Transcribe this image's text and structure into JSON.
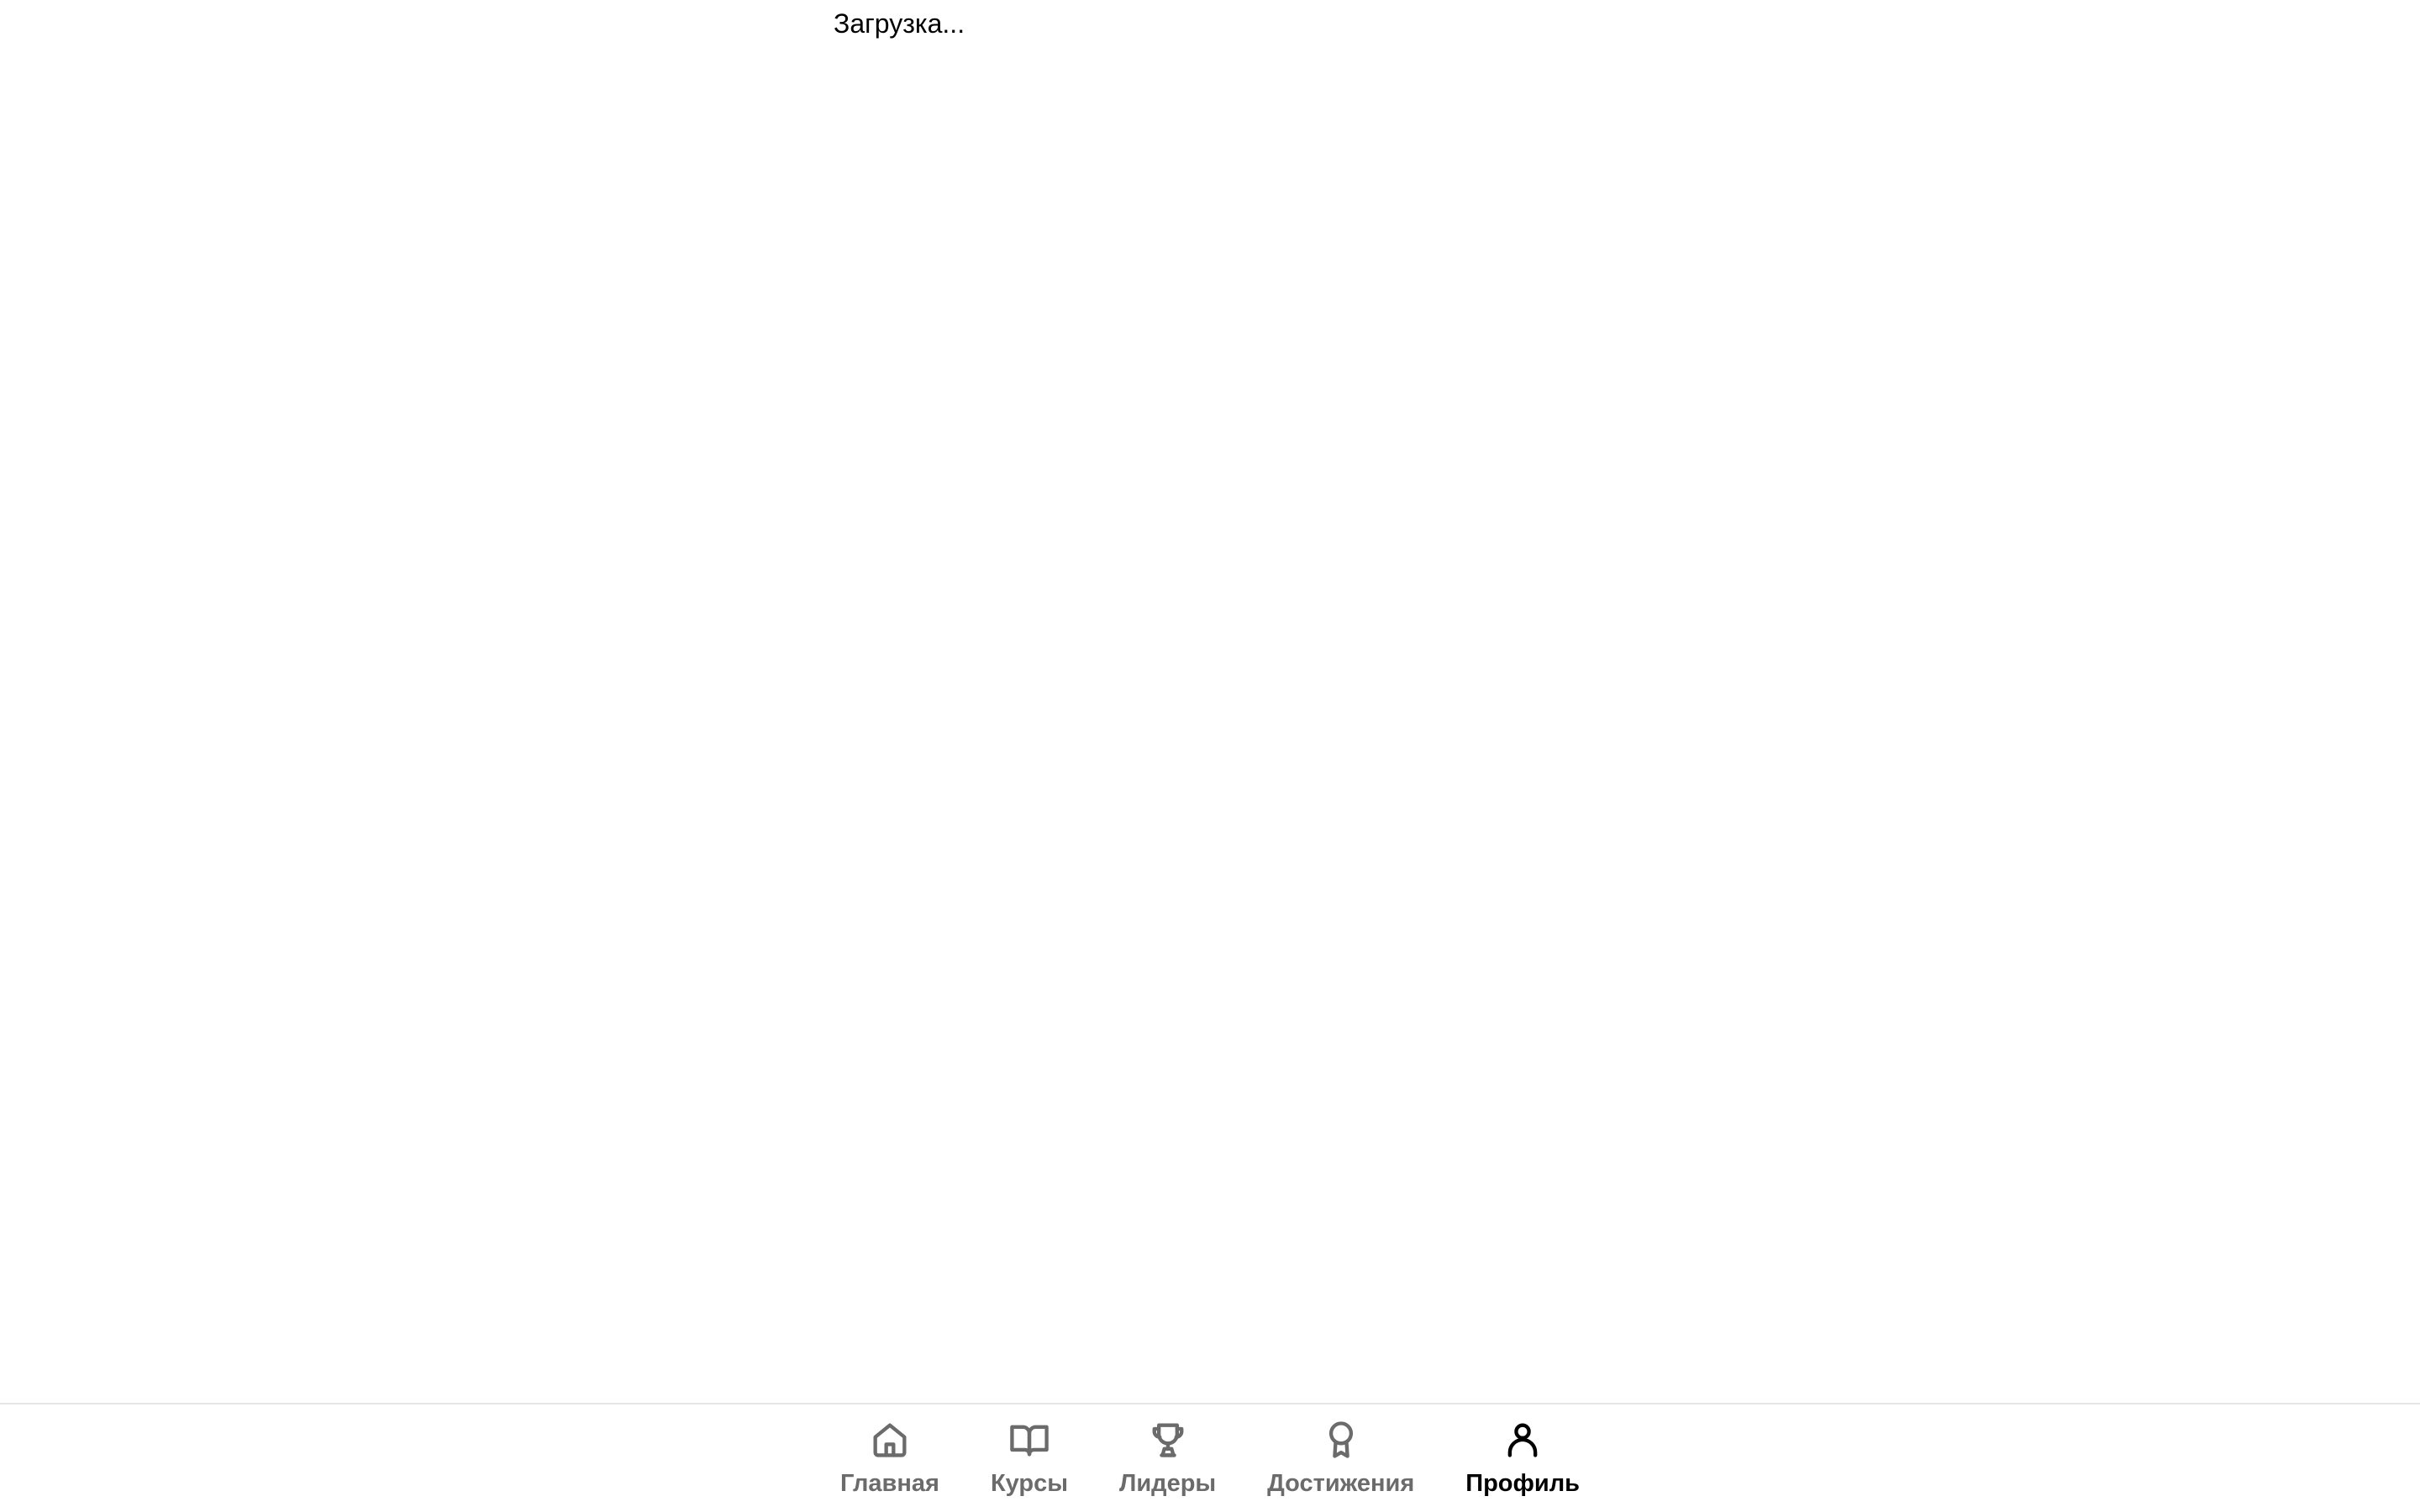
{
  "status": {
    "loading_text": "Загрузка..."
  },
  "nav": {
    "items": [
      {
        "id": "home",
        "label": "Главная",
        "icon": "home-icon",
        "active": false
      },
      {
        "id": "courses",
        "label": "Курсы",
        "icon": "book-open-icon",
        "active": false
      },
      {
        "id": "leaders",
        "label": "Лидеры",
        "icon": "trophy-icon",
        "active": false
      },
      {
        "id": "achievements",
        "label": "Достижения",
        "icon": "award-icon",
        "active": false
      },
      {
        "id": "profile",
        "label": "Профиль",
        "icon": "user-icon",
        "active": true
      }
    ]
  },
  "colors": {
    "active": "#000000",
    "inactive": "#6b6b6b",
    "border": "#e6e6e6",
    "background": "#ffffff"
  }
}
